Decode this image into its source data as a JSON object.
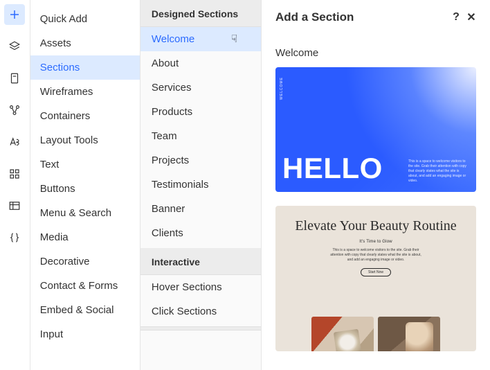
{
  "rail": {
    "icons": [
      "plus",
      "layers",
      "page",
      "structure",
      "text-style",
      "grid",
      "table",
      "braces"
    ],
    "active_index": 0
  },
  "categories": {
    "items": [
      "Quick Add",
      "Assets",
      "Sections",
      "Wireframes",
      "Containers",
      "Layout Tools",
      "Text",
      "Buttons",
      "Menu & Search",
      "Media",
      "Decorative",
      "Contact & Forms",
      "Embed & Social",
      "Input"
    ],
    "active_index": 2
  },
  "sub": {
    "groups": [
      {
        "header": "Designed Sections",
        "items": [
          "Welcome",
          "About",
          "Services",
          "Products",
          "Team",
          "Projects",
          "Testimonials",
          "Banner",
          "Clients"
        ],
        "active_index": 0
      },
      {
        "header": "Interactive",
        "items": [
          "Hover Sections",
          "Click Sections"
        ]
      }
    ]
  },
  "preview": {
    "title": "Add a Section",
    "help": "?",
    "close": "✕",
    "section_filter_label": "Welcome",
    "cards": [
      {
        "kind": "hello",
        "side_label": "WELCOME",
        "headline": "HELLO",
        "blurb": "This is a space to welcome visitors to the site. Grab their attention with copy that clearly states what the site is about, and add an engaging image or video."
      },
      {
        "kind": "beauty",
        "title": "Elevate Your Beauty Routine",
        "subtitle": "It's Time to Glow",
        "paragraph": "This is a space to welcome visitors to the site. Grab their attention with copy that clearly states what the site is about, and add an engaging image or video.",
        "button_label": "Start Now"
      }
    ]
  }
}
